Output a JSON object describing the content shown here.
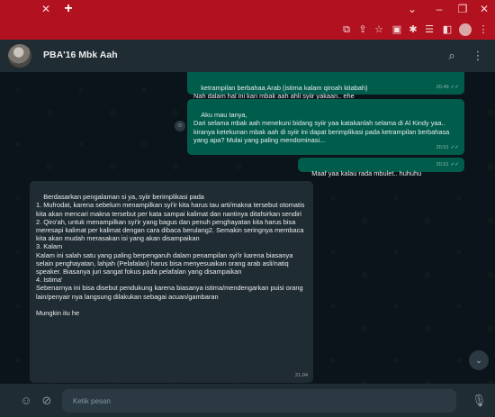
{
  "browser": {
    "tab_close": "✕",
    "new_tab": "+",
    "window_controls": {
      "chevron": "⌄",
      "minimize": "–",
      "restore": "❐",
      "close": "✕"
    },
    "toolbar_icons": [
      "screen-share-icon",
      "share-icon",
      "bookmark-star-icon",
      "extension-icon",
      "puzzle-icon",
      "reading-list-icon",
      "sidebar-icon",
      "profile-icon",
      "menu-icon"
    ]
  },
  "chat": {
    "title": "PBA'16 Mbk Aah",
    "header_icons": [
      "search-icon",
      "menu-icon"
    ]
  },
  "messages": [
    {
      "id": "m1",
      "direction": "out",
      "text": "ketrampilan berbahaa Arab (istima kalam qiroah kitabah)\nNah dalam hal ini kan mbak aah ahli syiir yakaan.. ehe",
      "time": "20.49",
      "status": "read"
    },
    {
      "id": "m2",
      "direction": "out",
      "text": "Aku mau tanya,\nDari selama mbak aah menekuni bidang syiir yaa katakanlah selama di Al Kindy yaa..\nkiranya ketekunan mbak aah di syiir ini dapat berimplikasi pada ketrampilan berbahasa yang apa? Mulai yang paling mendominasi...",
      "time": "20.51",
      "status": "read"
    },
    {
      "id": "m3",
      "direction": "out",
      "text": "Maaf yaa kalau rada mbulet.. huhuhu",
      "time": "20.51",
      "status": "read"
    },
    {
      "id": "m4",
      "direction": "in",
      "text": "Berdasarkan pengalaman si ya, syiir berimplikasi pada\n1. Mufrodat, karena sebelum menampilkan syi'ir kita harus tau arti/makna tersebut otomatis kita akan mencari makna tersebut per kata sampai kalimat dan nantinya ditafsirkan sendiri\n2. Qiro'ah, untuk menampilkan syi'ir yang bagus dan penuh penghayatan kita harus bisa meresapi kalimat per kalimat dengan cara dibaca berulang2. Semakin seringnya membaca kita akan mudah merasakan isi yang akan disampaikan\n3. Kalam\nKalam ini salah satu yang paling berpengaruh dalam penampilan syi'ir karena biasanya selain penghayatan, lahjah (Pelafalan) harus bisa menyesuaikan orang arab asli/natiq speaker. Biasanya juri sangat fokus pada pelafalan yang disampaikan\n4. Istima'\nSebenarnya ini bisa disebut pendukung karena biasanya istima/mendengarkan puisi orang lain/penyair nya langsung dilakukan sebagai acuan/gambaran\n\nMungkin itu he",
      "time": "21.04"
    }
  ],
  "composer": {
    "placeholder": "Ketik pesan",
    "icons": [
      "emoji-icon",
      "attach-icon",
      "mic-icon"
    ]
  },
  "colors": {
    "browser_bar": "#b2121f",
    "header": "#202c33",
    "background": "#0b141a",
    "outgoing": "#005c4b",
    "incoming": "#202c33",
    "read_ticks": "#8fc6d7"
  }
}
